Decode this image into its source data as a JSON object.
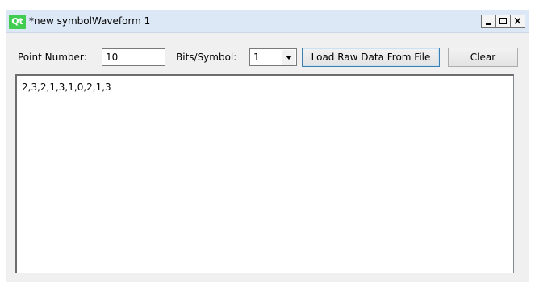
{
  "window": {
    "app_icon_text": "Qt",
    "title": "*new symbolWaveform 1",
    "controls": [
      "minimize",
      "maximize",
      "close"
    ]
  },
  "toolbar": {
    "point_number_label": "Point Number:",
    "point_number_value": "10",
    "bits_per_symbol_label": "Bits/Symbol:",
    "bits_per_symbol_value": "1",
    "load_button_label": "Load Raw Data From File",
    "clear_button_label": "Clear"
  },
  "editor": {
    "content": "2,3,2,1,3,1,0,2,1,3"
  },
  "icons": {
    "app": "qt-logo-icon",
    "minimize": "minimize-icon",
    "maximize": "maximize-icon",
    "close": "close-icon",
    "dropdown": "chevron-down-icon"
  },
  "colors": {
    "titlebar_bg": "#dde8f6",
    "window_bg": "#f0f0f0",
    "qt_green": "#41cd52",
    "focus_border": "#3c7fb1"
  }
}
